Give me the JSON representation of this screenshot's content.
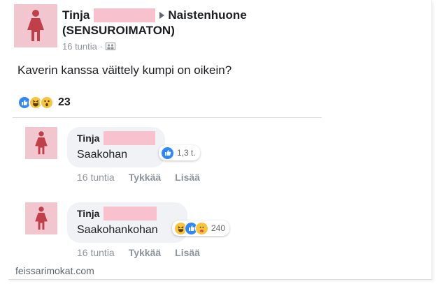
{
  "post": {
    "author_first": "Tinja",
    "group": "Naistenhuone",
    "group_line2": "(SENSUROIMATON)",
    "time": "16 tuntia",
    "separator": "·",
    "text": "Kaverin kanssa väittely kumpi on oikein?",
    "reaction_count": "23",
    "reactions": [
      "like-icon",
      "haha-icon",
      "wow-icon"
    ]
  },
  "comments": [
    {
      "author_first": "Tinja",
      "text": "Saakohan",
      "reactions": [
        "like-icon"
      ],
      "reaction_count": "1,3 t.",
      "time": "16 tuntia",
      "like_label": "Tykkää",
      "more_label": "Lisää"
    },
    {
      "author_first": "Tinja",
      "text": "Saakohankohan",
      "reactions": [
        "haha-icon",
        "like-icon",
        "care-icon"
      ],
      "reaction_count": "240",
      "time": "16 tuntia",
      "like_label": "Tykkää",
      "more_label": "Lisää"
    }
  ],
  "watermark": "feissarimokat.com",
  "colors": {
    "like": "#2d88ff",
    "emoji": "#f7c43a",
    "redaction": "#f7c2ce",
    "avatar_bg": "#f2c6cf",
    "avatar_figure": "#c0404a"
  }
}
